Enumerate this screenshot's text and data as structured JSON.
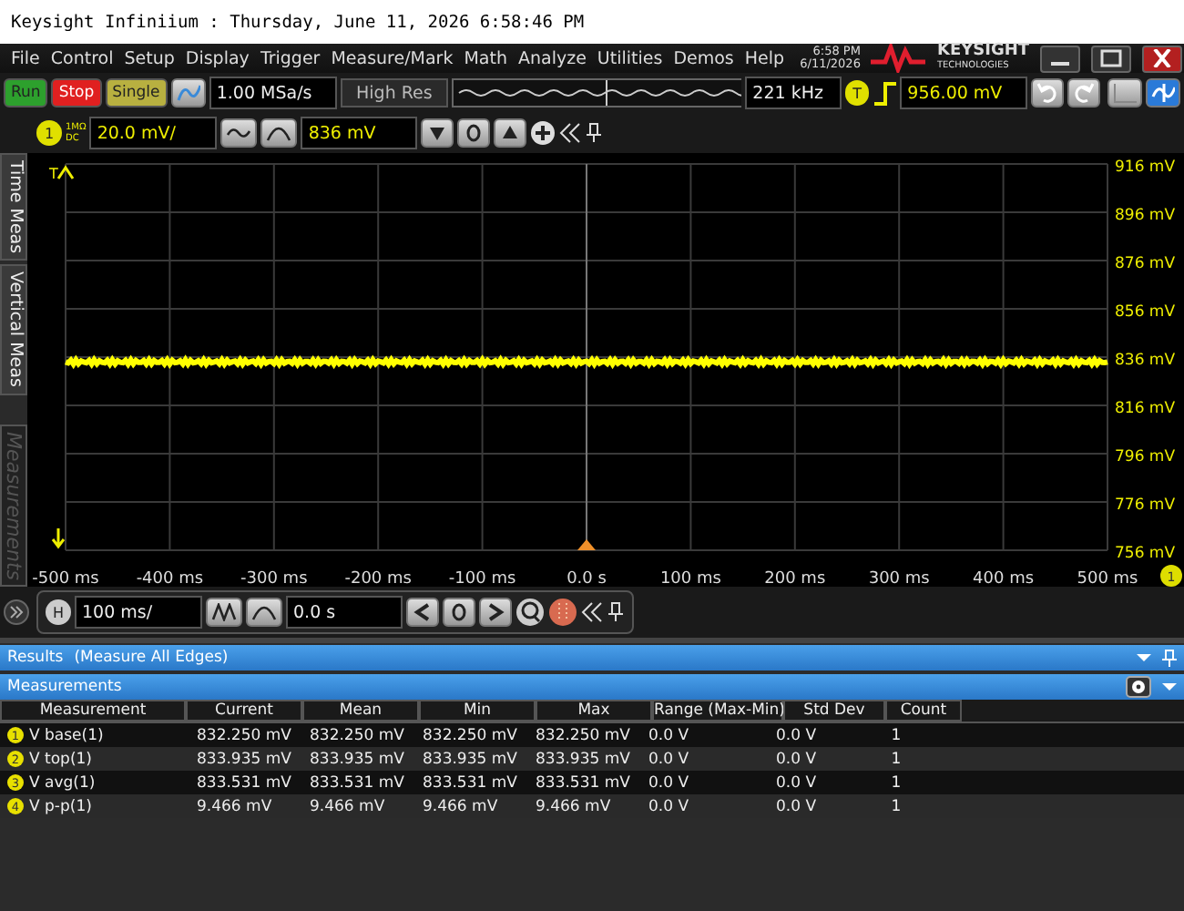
{
  "title": "Keysight Infiniium : Thursday, June 11, 2026 6:58:46 PM",
  "menu": [
    "File",
    "Control",
    "Setup",
    "Display",
    "Trigger",
    "Measure/Mark",
    "Math",
    "Analyze",
    "Utilities",
    "Demos",
    "Help"
  ],
  "clock": {
    "time": "6:58 PM",
    "date": "6/11/2026"
  },
  "brand": {
    "name": "KEYSIGHT",
    "sub": "TECHNOLOGIES"
  },
  "toolbar": {
    "buttons": [
      {
        "label": "Run",
        "kind": "run"
      },
      {
        "label": "Stop",
        "kind": "stop"
      },
      {
        "label": "Single",
        "kind": "single"
      }
    ],
    "sample_rate": "1.00 MSa/s",
    "acq_mode": "High Res",
    "frequency": "221 kHz",
    "trigger_badge": "T",
    "trigger_level": "956.00 mV"
  },
  "channel": {
    "badge": "1",
    "impedance": "1MΩ",
    "coupling": "DC",
    "scale": "20.0 mV/",
    "offset": "836 mV"
  },
  "side_tabs": [
    {
      "label": "Time Meas",
      "disabled": false
    },
    {
      "label": "Vertical Meas",
      "disabled": false
    },
    {
      "label": "Measurements",
      "disabled": true
    }
  ],
  "plot": {
    "trigger_marker": "T",
    "chart_data": {
      "type": "line",
      "x": [
        -500,
        -400,
        -300,
        -200,
        -100,
        0,
        100,
        200,
        300,
        400,
        500
      ],
      "series": [
        {
          "name": "1",
          "color": "#ffff00",
          "values": [
            834,
            834,
            834,
            834,
            834,
            834,
            834,
            834,
            834,
            834,
            834
          ]
        }
      ],
      "grid": true,
      "ref_lines": [
        {
          "axis": "x",
          "value": 0
        }
      ],
      "xlim": [
        -500,
        500
      ],
      "ylim": [
        756,
        916
      ],
      "xticks": [
        {
          "value": -500,
          "label": "-500 ms"
        },
        {
          "value": -400,
          "label": "-400 ms"
        },
        {
          "value": -300,
          "label": "-300 ms"
        },
        {
          "value": -200,
          "label": "-200 ms"
        },
        {
          "value": -100,
          "label": "-100 ms"
        },
        {
          "value": 0,
          "label": "0.0 s"
        },
        {
          "value": 100,
          "label": "100 ms"
        },
        {
          "value": 200,
          "label": "200 ms"
        },
        {
          "value": 300,
          "label": "300 ms"
        },
        {
          "value": 400,
          "label": "400 ms"
        },
        {
          "value": 500,
          "label": "500 ms"
        }
      ],
      "yticks": [
        {
          "value": 916,
          "label": "916 mV"
        },
        {
          "value": 896,
          "label": "896 mV"
        },
        {
          "value": 876,
          "label": "876 mV"
        },
        {
          "value": 856,
          "label": "856 mV"
        },
        {
          "value": 836,
          "label": "836 mV"
        },
        {
          "value": 816,
          "label": "816 mV"
        },
        {
          "value": 796,
          "label": "796 mV"
        },
        {
          "value": 776,
          "label": "776 mV"
        },
        {
          "value": 756,
          "label": "756 mV"
        }
      ]
    }
  },
  "horizontal": {
    "badge": "H",
    "scale": "100 ms/",
    "position": "0.0 s"
  },
  "results": {
    "title": "Results",
    "subtitle": "(Measure All Edges)"
  },
  "measurements": {
    "title": "Measurements",
    "columns": [
      "Measurement",
      "Current",
      "Mean",
      "Min",
      "Max",
      "Range (Max-Min)",
      "Std Dev",
      "Count"
    ],
    "rows": [
      {
        "badge": "1",
        "cells": [
          "V base(1)",
          "832.250 mV",
          "832.250 mV",
          "832.250 mV",
          "832.250 mV",
          "0.0 V",
          "0.0 V",
          "1"
        ]
      },
      {
        "badge": "2",
        "cells": [
          "V top(1)",
          "833.935 mV",
          "833.935 mV",
          "833.935 mV",
          "833.935 mV",
          "0.0 V",
          "0.0 V",
          "1"
        ]
      },
      {
        "badge": "3",
        "cells": [
          "V avg(1)",
          "833.531 mV",
          "833.531 mV",
          "833.531 mV",
          "833.531 mV",
          "0.0 V",
          "0.0 V",
          "1"
        ]
      },
      {
        "badge": "4",
        "cells": [
          "V p-p(1)",
          "9.466 mV",
          "9.466 mV",
          "9.466 mV",
          "9.466 mV",
          "0.0 V",
          "0.0 V",
          "1"
        ]
      }
    ]
  }
}
